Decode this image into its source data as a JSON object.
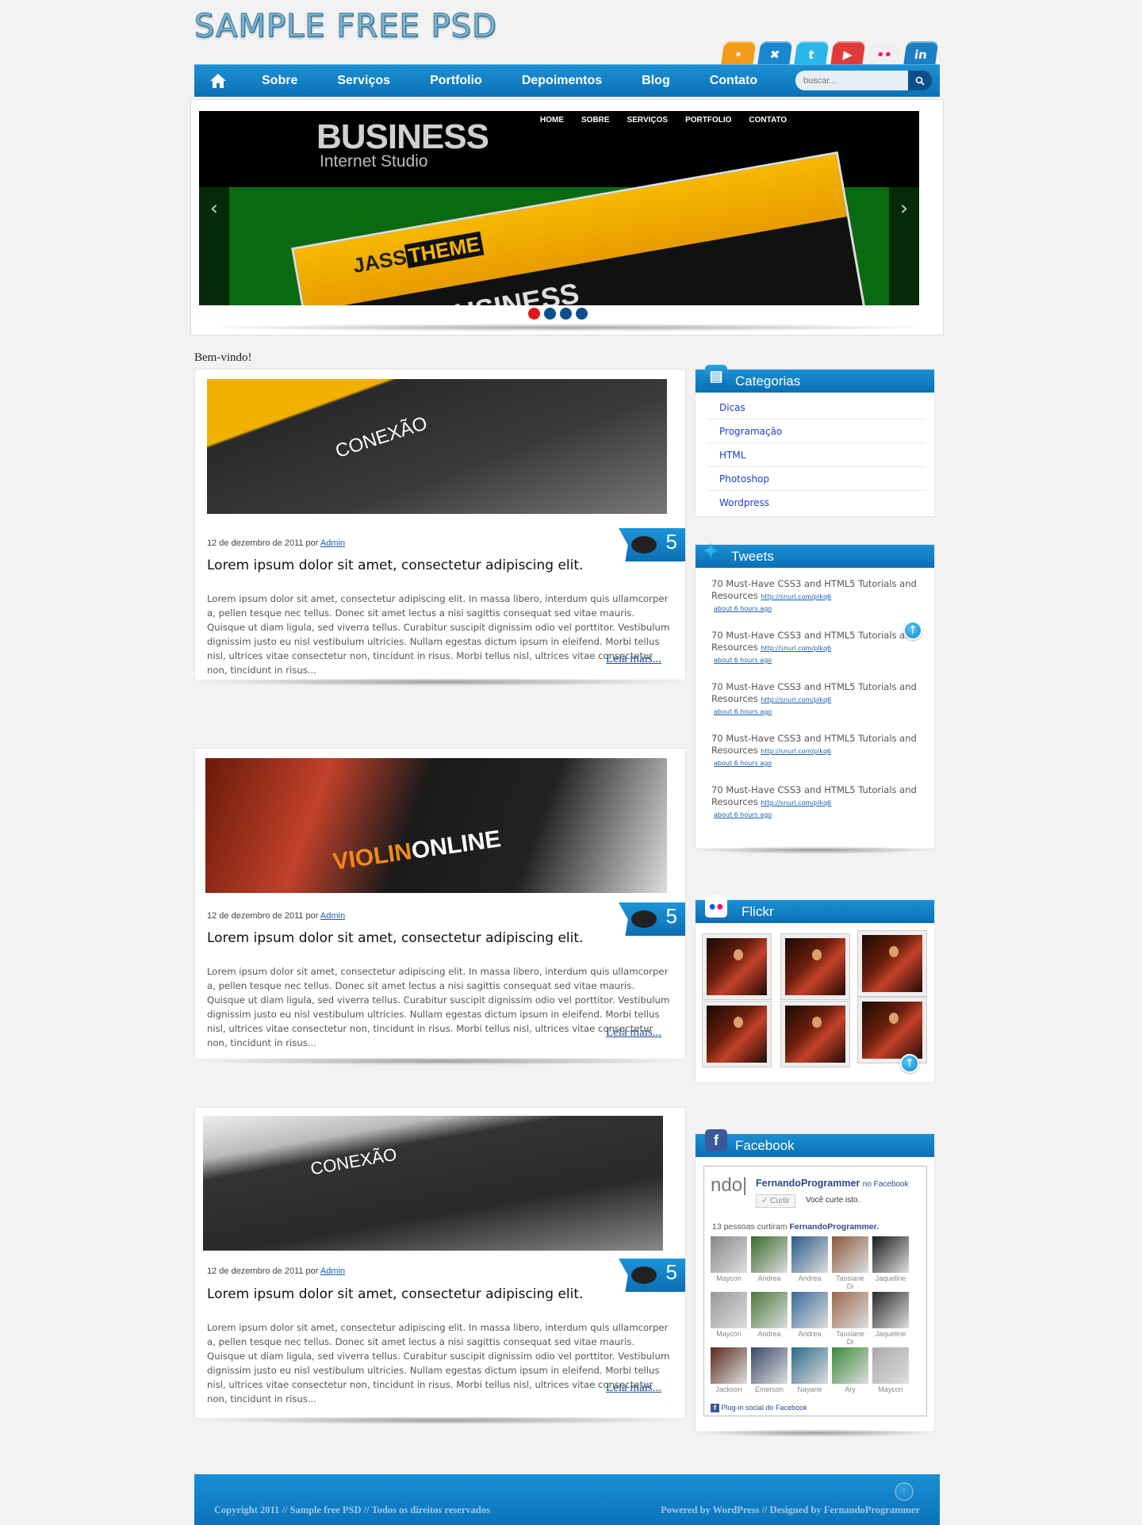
{
  "site": {
    "logo": "SAMPLE FREE PSD"
  },
  "social": [
    {
      "icon": "rss-icon",
      "glyph": "•",
      "color": "#f39a1a"
    },
    {
      "icon": "delicious-icon",
      "glyph": "✖",
      "color": "#1a86d0"
    },
    {
      "icon": "twitter-icon",
      "glyph": "t",
      "color": "#2ab6e8"
    },
    {
      "icon": "youtube-icon",
      "glyph": "▶",
      "color": "#e23a3a"
    },
    {
      "icon": "flickr-icon",
      "glyph": "••",
      "color": "#f0f0f0"
    },
    {
      "icon": "linkedin-icon",
      "glyph": "in",
      "color": "#1c7fc4"
    }
  ],
  "nav": {
    "items": [
      "Sobre",
      "Serviços",
      "Portfolio",
      "Depoimentos",
      "Blog",
      "Contato"
    ],
    "search_placeholder": "buscar..."
  },
  "slider": {
    "title": "BUSINESS",
    "subtitle": "Internet Studio",
    "menu": [
      "HOME",
      "SOBRE",
      "SERVIÇOS",
      "PORTFOLIO",
      "CONTATO"
    ],
    "inner_theme": "JASS",
    "inner_theme_highlight": "THEME",
    "inner_title": "BUSINESS",
    "slides_total": 4,
    "active_slide": 1
  },
  "welcome": "Bem-vindo!",
  "posts": [
    {
      "date": "12 de dezembro de 2011 por",
      "author": "Admin",
      "title": "Lorem ipsum dolor sit amet, consectetur adipiscing elit.",
      "body": "Lorem ipsum dolor sit amet, consectetur adipiscing elit. In massa libero, interdum quis ullamcorper a, pellen tesque nec tellus. Donec sit amet lectus a nisi sagittis consequat sed vitae mauris. Quisque ut diam ligula, sed viverra tellus. Curabitur suscipit dignissim odio vel porttitor. Vestibulum dignissim justo eu nisl vestibulum ultricies. Nullam egestas dictum ipsum in eleifend. Morbi tellus nisl, ultrices vitae consectetur non, tincidunt in risus. Morbi tellus nisl, ultrices vitae consectetur non, tincidunt in risus...",
      "more": "Leia mais...",
      "comments": "5",
      "thumb_label": "CONEXÃO"
    },
    {
      "date": "12 de dezembro de 2011 por",
      "author": "Admin",
      "title": "Lorem ipsum dolor sit amet, consectetur adipiscing elit.",
      "body": "Lorem ipsum dolor sit amet, consectetur adipiscing elit. In massa libero, interdum quis ullamcorper a, pellen tesque nec tellus. Donec sit amet lectus a nisi sagittis consequat sed vitae mauris. Quisque ut diam ligula, sed viverra tellus. Curabitur suscipit dignissim odio vel porttitor. Vestibulum dignissim justo eu nisl vestibulum ultricies. Nullam egestas dictum ipsum in eleifend. Morbi tellus nisl, ultrices vitae consectetur non, tincidunt in risus. Morbi tellus nisl, ultrices vitae consectetur non, tincidunt in risus...",
      "more": "Leia mais...",
      "comments": "5",
      "thumb_label": "VIOLIN",
      "thumb_label2": "ONLINE"
    },
    {
      "date": "12 de dezembro de 2011 por",
      "author": "Admin",
      "title": "Lorem ipsum dolor sit amet, consectetur adipiscing elit.",
      "body": "Lorem ipsum dolor sit amet, consectetur adipiscing elit. In massa libero, interdum quis ullamcorper a, pellen tesque nec tellus. Donec sit amet lectus a nisi sagittis consequat sed vitae mauris. Quisque ut diam ligula, sed viverra tellus. Curabitur suscipit dignissim odio vel porttitor. Vestibulum dignissim justo eu nisl vestibulum ultricies. Nullam egestas dictum ipsum in eleifend. Morbi tellus nisl, ultrices vitae consectetur non, tincidunt in risus. Morbi tellus nisl, ultrices vitae consectetur non, tincidunt in risus...",
      "more": "Leia mais...",
      "comments": "5",
      "thumb_label": "CONEXÃO"
    }
  ],
  "sidebar": {
    "categorias": {
      "title": "Categorias",
      "items": [
        "Dicas",
        "Programação",
        "HTML",
        "Photoshop",
        "Wordpress"
      ]
    },
    "tweets": {
      "title": "Tweets",
      "items": [
        {
          "text": "70 Must-Have CSS3 and HTML5 Tutorials and Resources",
          "link": "http://snurl.com/plkq6",
          "ago": "about 6 hours ago"
        },
        {
          "text": "70 Must-Have CSS3 and HTML5 Tutorials and Resources",
          "link": "http://snurl.com/plkq6",
          "ago": "about 6 hours ago"
        },
        {
          "text": "70 Must-Have CSS3 and HTML5 Tutorials and Resources",
          "link": "http://snurl.com/plkq6",
          "ago": "about 6 hours ago"
        },
        {
          "text": "70 Must-Have CSS3 and HTML5 Tutorials and Resources",
          "link": "http://snurl.com/plkq6",
          "ago": "about 6 hours ago"
        },
        {
          "text": "70 Must-Have CSS3 and HTML5 Tutorials and Resources",
          "link": "http://snurl.com/plkq6",
          "ago": "about 6 hours ago"
        }
      ]
    },
    "flickr": {
      "title": "Flickr",
      "photos": 6
    },
    "facebook": {
      "title": "Facebook",
      "page_name": "FernandoProgrammer",
      "on_facebook": "no Facebook",
      "like_button": "Curtir",
      "you_like": "Você curte isto.",
      "count_text": "13 pessoas curtiram",
      "count_name": "FernandoProgrammer.",
      "fans": [
        "Maycon",
        "Andrea",
        "Andrea",
        "Tassiane Di",
        "Jaqueline",
        "Maycon",
        "Andrea",
        "Andrea",
        "Tassiane Di",
        "Jaqueline",
        "Jackson",
        "Emerson",
        "Nayane",
        "Ary",
        "Maycon"
      ],
      "plugin": "Plug-in social do Facebook"
    }
  },
  "footer": {
    "left": "Copyright 2011 // Sample free PSD // Todos os direitos reservados",
    "right": "Powered by WordPress // Designed by FernandoProgrammer"
  }
}
